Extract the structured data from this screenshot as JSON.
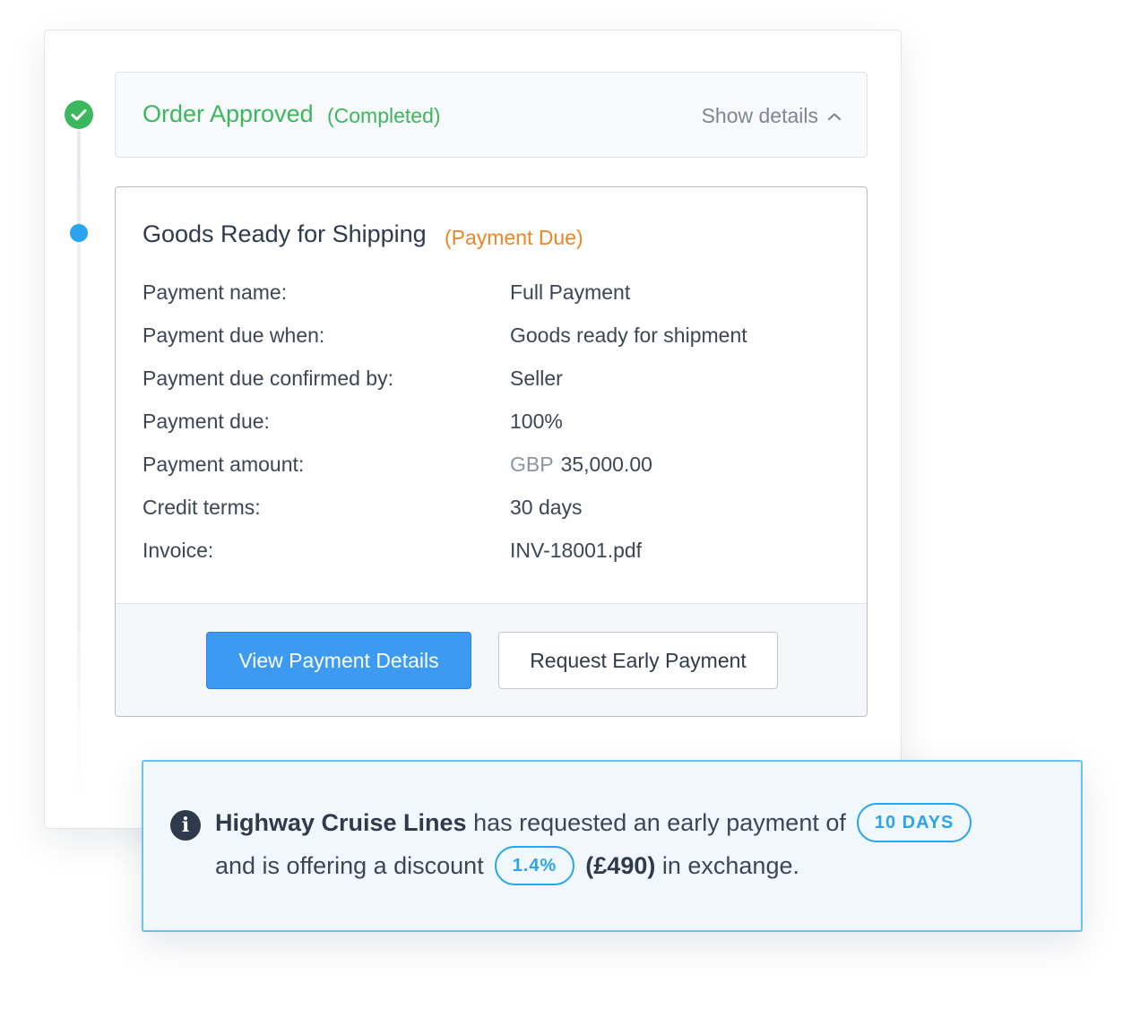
{
  "colors": {
    "success": "#3bb75e",
    "warning": "#ef8423",
    "accent": "#2aa4ee",
    "primary_button": "#3d9af2",
    "link": "#1a67c5"
  },
  "steps": {
    "approved": {
      "title": "Order Approved",
      "status": "(Completed)",
      "toggle_label": "Show details",
      "icon": "check-circle-icon"
    },
    "shipping": {
      "title": "Goods Ready for Shipping",
      "status": "(Payment Due)",
      "rows": [
        {
          "label": "Payment name:",
          "value": "Full Payment"
        },
        {
          "label": "Payment due when:",
          "value": "Goods ready for shipment"
        },
        {
          "label": "Payment due confirmed by:",
          "value": "Seller"
        },
        {
          "label": "Payment due:",
          "value": "100%"
        },
        {
          "label": "Payment amount:",
          "currency": "GBP",
          "value": "35,000.00"
        },
        {
          "label": "Credit terms:",
          "value": "30 days"
        },
        {
          "label": "Invoice:",
          "value": "INV-18001.pdf"
        }
      ],
      "buttons": {
        "primary": "View Payment Details",
        "secondary": "Request Early Payment"
      }
    }
  },
  "notice": {
    "icon": "info-icon",
    "icon_glyph": "i",
    "company": "Highway Cruise Lines",
    "text_1": "has requested an early payment of",
    "days_badge": "10 DAYS",
    "text_2": "and is offering a discount",
    "discount_badge": "1.4%",
    "discount_amount": "(£490)",
    "text_3": "in exchange."
  }
}
